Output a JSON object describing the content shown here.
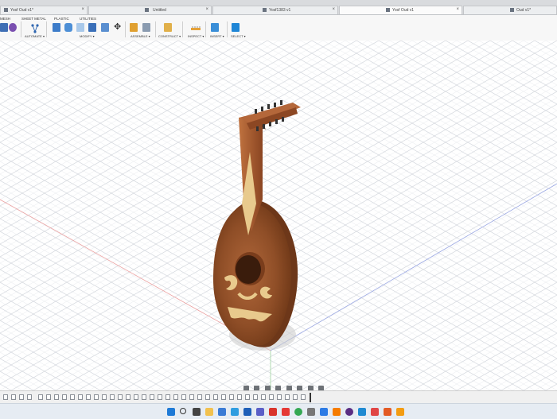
{
  "tabs": [
    {
      "label": "Yosf Oud v1*",
      "active": false
    },
    {
      "label": "Untitled",
      "active": false
    },
    {
      "label": "Yosf1383 v1",
      "active": false
    },
    {
      "label": "Yosf Oud v1",
      "active": true
    },
    {
      "label": "Oud v1*",
      "active": false
    }
  ],
  "workspace_tabs": [
    "MESH",
    "SHEET METAL",
    "PLASTIC",
    "UTILITIES"
  ],
  "groups": [
    "AUTOMATE ▾",
    "MODIFY ▾",
    "ASSEMBLE ▾",
    "CONSTRUCT ▾",
    "INSPECT ▾",
    "INSERT ▾",
    "SELECT ▾"
  ],
  "colors": {
    "body": "#8a4a25",
    "inlay": "#e7c98c",
    "grid": "#c9ced6",
    "x_axis": "#e8a0a0",
    "y_axis": "#9aa8e0",
    "z_axis": "#9fd29f"
  },
  "icons": {
    "nav": [
      "orbit-icon",
      "look-at-icon",
      "pan-icon",
      "zoom-icon",
      "fit-icon",
      "display-settings-icon",
      "grid-settings-icon",
      "viewports-icon"
    ],
    "taskbar": [
      "windows-start-icon",
      "search-icon",
      "file-explorer-icon",
      "folder-icon",
      "store-icon",
      "photos-icon",
      "word-icon",
      "teams-icon",
      "acrobat-icon",
      "youtube-icon",
      "chrome-icon",
      "settings-icon",
      "photos2-icon",
      "fusion-icon",
      "obs-icon",
      "vscode-icon",
      "vivaldi-icon",
      "office-icon",
      "fusion360-icon"
    ]
  }
}
